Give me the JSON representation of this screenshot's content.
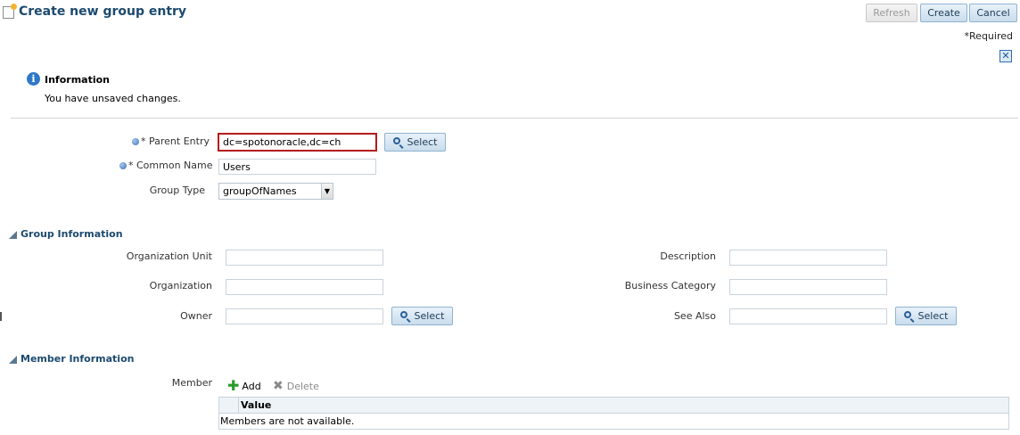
{
  "header": {
    "title": "Create new group entry",
    "refresh_label": "Refresh",
    "create_label": "Create",
    "cancel_label": "Cancel",
    "required_note": "*Required"
  },
  "info": {
    "title": "Information",
    "message": "You have unsaved changes."
  },
  "form": {
    "parent_entry": {
      "label": "* Parent Entry",
      "value": "dc=spotonoracle,dc=ch"
    },
    "common_name": {
      "label": "* Common Name",
      "value": "Users"
    },
    "group_type": {
      "label": "Group Type",
      "selected": "groupOfNames"
    },
    "select_label": "Select"
  },
  "group_info": {
    "heading": "Group Information",
    "organization_unit": {
      "label": "Organization Unit",
      "value": ""
    },
    "organization": {
      "label": "Organization",
      "value": ""
    },
    "owner": {
      "label": "Owner",
      "value": ""
    },
    "description": {
      "label": "Description",
      "value": ""
    },
    "business_category": {
      "label": "Business Category",
      "value": ""
    },
    "see_also": {
      "label": "See Also",
      "value": ""
    }
  },
  "member_info": {
    "heading": "Member Information",
    "member_label": "Member",
    "add_label": "Add",
    "delete_label": "Delete",
    "column_value": "Value",
    "empty_text": "Members are not available."
  },
  "colors": {
    "title": "#1c4a6e",
    "error_border": "#b31b1b",
    "button_fill": "#c9dcec",
    "info_icon": "#2f78c7"
  },
  "icons": {
    "page": "page-edit-icon",
    "info": "info-icon",
    "close": "close-icon",
    "search": "search-icon",
    "add": "add-icon",
    "delete": "delete-icon",
    "collapse": "collapse-triangle-icon",
    "required": "required-dot-icon"
  }
}
